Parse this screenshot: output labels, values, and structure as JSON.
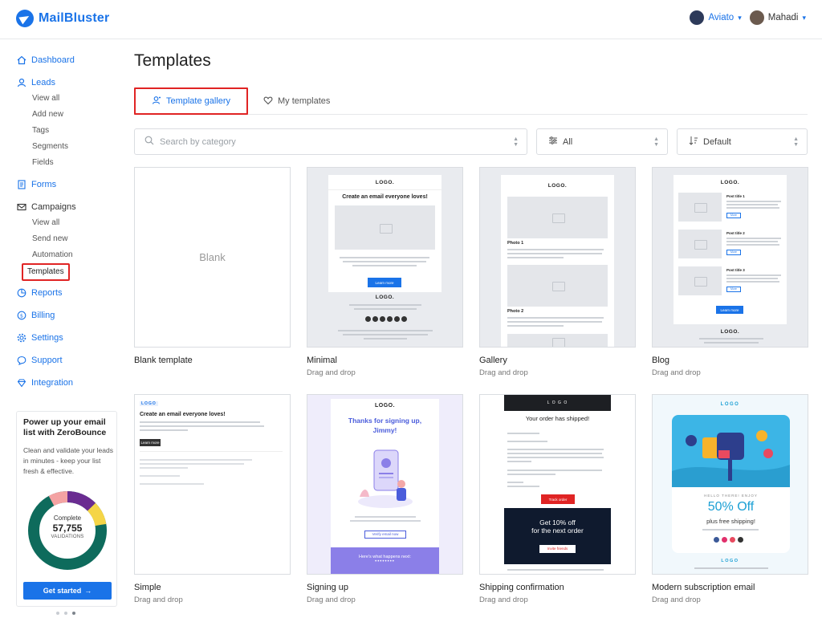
{
  "brand": {
    "name": "MailBluster",
    "accent": "#1a73e8",
    "highlight": "#e02424"
  },
  "topbar": {
    "org": {
      "name": "Aviato",
      "icon": "org-avatar"
    },
    "user": {
      "name": "Mahadi",
      "icon": "user-avatar"
    },
    "chevron": "⌄"
  },
  "sidebar": {
    "items": [
      {
        "label": "Dashboard",
        "icon": "home-icon"
      },
      {
        "label": "Leads",
        "icon": "user-icon",
        "children": [
          "View all",
          "Add new",
          "Tags",
          "Segments",
          "Fields"
        ]
      },
      {
        "label": "Forms",
        "icon": "form-icon"
      },
      {
        "label": "Campaigns",
        "icon": "mail-icon",
        "children": [
          "View all",
          "Send new",
          "Automation",
          "Templates"
        ]
      },
      {
        "label": "Reports",
        "icon": "chart-icon"
      },
      {
        "label": "Billing",
        "icon": "dollar-icon"
      },
      {
        "label": "Settings",
        "icon": "gear-icon"
      },
      {
        "label": "Support",
        "icon": "chat-icon"
      },
      {
        "label": "Integration",
        "icon": "diamond-icon"
      }
    ],
    "active_sub": "Templates"
  },
  "promo": {
    "title": "Power up your email list with ZeroBounce",
    "desc": "Clean and validate your leads in minutes - keep your list fresh & effective.",
    "donut_top": "Complete",
    "donut_value": "57,755",
    "donut_bottom": "VALIDATIONS",
    "cta": "Get started",
    "cta_icon": "→",
    "carousel_active_index": 2
  },
  "main": {
    "title": "Templates",
    "tabs": {
      "gallery": "Template gallery",
      "mine": "My templates"
    },
    "search": {
      "placeholder": "Search by category"
    },
    "category_filter": "All",
    "sort": "Default"
  },
  "templates": [
    {
      "name": "Blank template",
      "sub": "",
      "thumb": "Blank"
    },
    {
      "name": "Minimal",
      "sub": "Drag and drop"
    },
    {
      "name": "Gallery",
      "sub": "Drag and drop"
    },
    {
      "name": "Blog",
      "sub": "Drag and drop"
    },
    {
      "name": "Simple",
      "sub": "Drag and drop"
    },
    {
      "name": "Signing up",
      "sub": "Drag and drop"
    },
    {
      "name": "Shipping confirmation",
      "sub": "Drag and drop"
    },
    {
      "name": "Modern subscription email",
      "sub": "Drag and drop"
    }
  ],
  "thumbs": {
    "minimal": {
      "logo": "LOGO.",
      "headline": "Create an email everyone loves!",
      "button": "Learn more",
      "footer_logo": "LOGO."
    },
    "gallery": {
      "logo": "LOGO.",
      "photo1": "Photo 1",
      "photo2": "Photo 2"
    },
    "blog": {
      "logo": "LOGO.",
      "posts": [
        "Post title 1",
        "Post title 2",
        "Post title 3"
      ],
      "more": "More",
      "button": "Learn more",
      "footer_logo": "LOGO."
    },
    "simple": {
      "logo": "LOGO",
      "headline": "Create an email everyone loves!",
      "button": "Learn more"
    },
    "signup": {
      "logo": "LOGO.",
      "headline": "Thanks for signing up, Jimmy!",
      "button": "Verify email now",
      "footer": "Here's what happens next:"
    },
    "shipping": {
      "logo": "L O G O",
      "headline": "Your order has shipped!",
      "button": "Track order",
      "promo1": "Get 10% off",
      "promo2": "for the next order",
      "promo_btn": "Invite friends"
    },
    "modern": {
      "logo": "LOGO",
      "hello": "HELLO THERE! ENJOY",
      "offer": "50% Off",
      "offer_sub": "plus free shipping!",
      "footer_logo": "LOGO"
    }
  }
}
